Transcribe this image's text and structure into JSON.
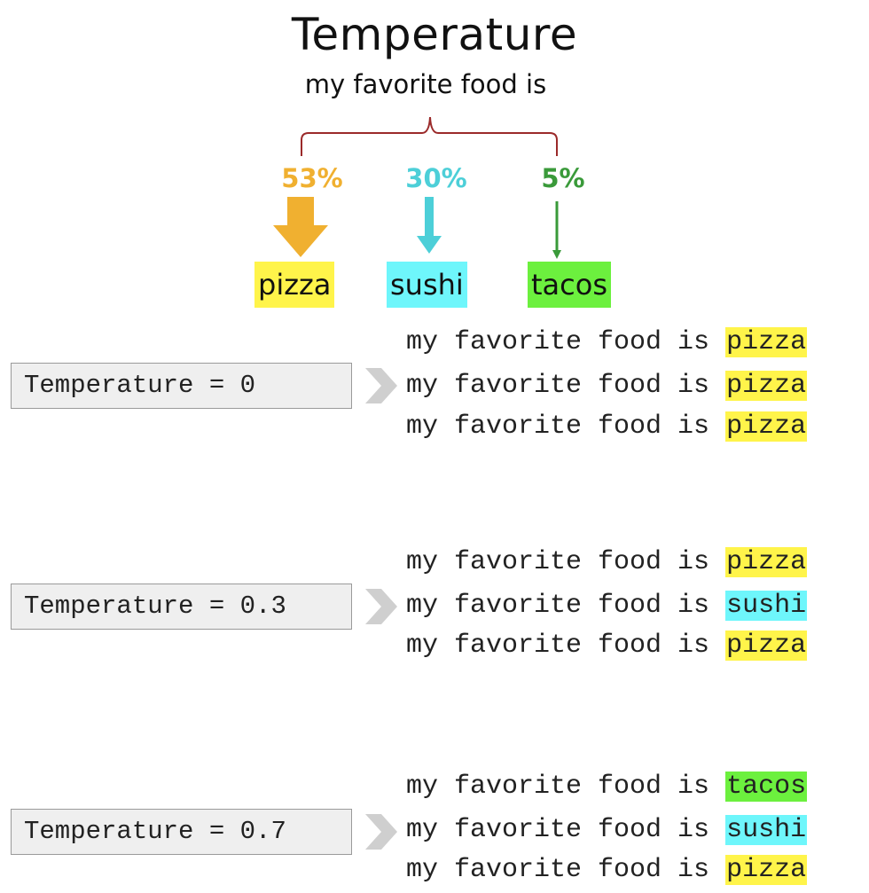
{
  "header": {
    "title": "Temperature",
    "prompt": "my favorite food is"
  },
  "candidates": [
    {
      "token": "pizza",
      "probability": "53%",
      "color": "#f0b030",
      "highlight": "#fff44a"
    },
    {
      "token": "sushi",
      "probability": "30%",
      "color": "#4dcfd8",
      "highlight": "#6ef6fb"
    },
    {
      "token": "tacos",
      "probability": "5%",
      "color": "#3a9a3a",
      "highlight": "#6cf03e"
    }
  ],
  "examples": [
    {
      "label": "Temperature = 0",
      "lines": [
        {
          "prefix": "my favorite food is ",
          "token": "pizza"
        },
        {
          "prefix": "my favorite food is ",
          "token": "pizza"
        },
        {
          "prefix": "my favorite food is ",
          "token": "pizza"
        }
      ]
    },
    {
      "label": "Temperature = 0.3",
      "lines": [
        {
          "prefix": "my favorite food is ",
          "token": "pizza"
        },
        {
          "prefix": "my favorite food is ",
          "token": "sushi"
        },
        {
          "prefix": "my favorite food is ",
          "token": "pizza"
        }
      ]
    },
    {
      "label": "Temperature = 0.7",
      "lines": [
        {
          "prefix": "my favorite food is ",
          "token": "tacos"
        },
        {
          "prefix": "my favorite food is ",
          "token": "sushi"
        },
        {
          "prefix": "my favorite food is ",
          "token": "pizza"
        }
      ]
    }
  ],
  "colors": {
    "brace": "#9b2a2a",
    "chevron": "#cfcfcf",
    "pizza": "#fff44a",
    "sushi": "#6ef6fb",
    "tacos": "#6cf03e"
  }
}
